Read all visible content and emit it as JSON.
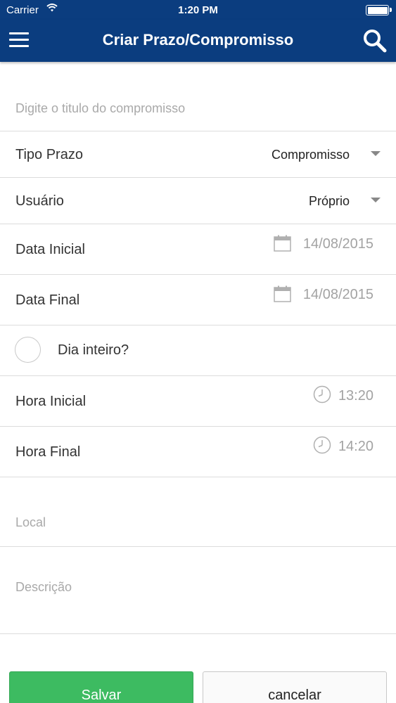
{
  "status_bar": {
    "carrier": "Carrier",
    "time": "1:20 PM",
    "wifi_icon": "wifi-icon",
    "battery_icon": "battery-icon"
  },
  "nav": {
    "title": "Criar Prazo/Compromisso",
    "menu_icon": "hamburger-menu-icon",
    "search_icon": "search-icon",
    "color": "#0b3d7f"
  },
  "form": {
    "title_placeholder": "Digite o titulo do compromisso",
    "tipo_prazo": {
      "label": "Tipo Prazo",
      "value": "Compromisso"
    },
    "usuario": {
      "label": "Usuário",
      "value": "Próprio"
    },
    "data_inicial": {
      "label": "Data Inicial",
      "value": "14/08/2015"
    },
    "data_final": {
      "label": "Data Final",
      "value": "14/08/2015"
    },
    "dia_inteiro": {
      "label": "Dia inteiro?",
      "checked": false
    },
    "hora_inicial": {
      "label": "Hora Inicial",
      "value": "13:20"
    },
    "hora_final": {
      "label": "Hora Final",
      "value": "14:20"
    },
    "local_placeholder": "Local",
    "descricao_placeholder": "Descrição"
  },
  "buttons": {
    "save_label": "Salvar",
    "cancel_label": "cancelar",
    "save_color": "#3dbb61"
  }
}
